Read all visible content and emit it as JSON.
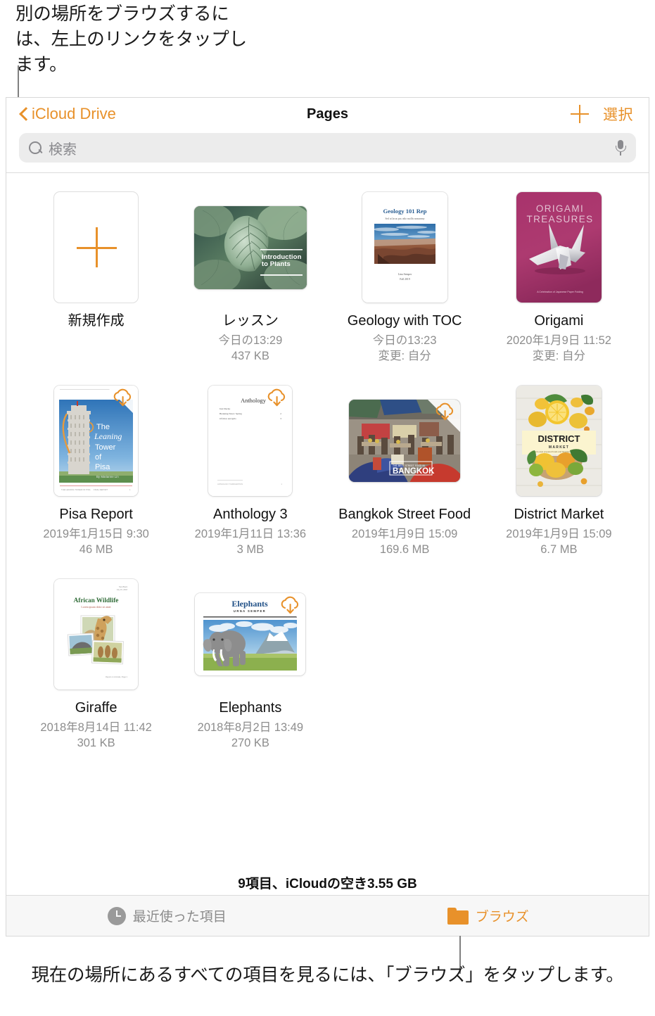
{
  "callouts": {
    "top": "別の場所をブラウズするには、左上のリンクをタップします。",
    "bottom": "現在の場所にあるすべての項目を見るには、「ブラウズ」をタップします。"
  },
  "navbar": {
    "back_label": "iCloud Drive",
    "back_icon": "chevron-left-icon",
    "title": "Pages",
    "add_icon": "plus-icon",
    "select_label": "選択"
  },
  "search": {
    "placeholder": "検索",
    "value": "",
    "icon": "search-icon",
    "mic_icon": "microphone-icon"
  },
  "grid": {
    "new_document_label": "新規作成",
    "items": [
      {
        "title": "レッスン",
        "date": "今日の13:29",
        "size": "437 KB",
        "cloud": false,
        "shape": "landscape",
        "cover": "lesson"
      },
      {
        "title": "Geology with TOC",
        "date": "今日の13:23",
        "size": "変更: 自分",
        "cloud": false,
        "shape": "portrait",
        "cover": "geology"
      },
      {
        "title": "Origami",
        "date": "2020年1月9日 11:52",
        "size": "変更: 自分",
        "cloud": false,
        "shape": "portrait",
        "cover": "origami"
      },
      {
        "title": "Pisa Report",
        "date": "2019年1月15日 9:30",
        "size": "46 MB",
        "cloud": true,
        "shape": "portrait",
        "cover": "pisa"
      },
      {
        "title": "Anthology 3",
        "date": "2019年1月11日 13:36",
        "size": "3 MB",
        "cloud": true,
        "shape": "portrait",
        "cover": "anthology"
      },
      {
        "title": "Bangkok Street Food",
        "date": "2019年1月9日 15:09",
        "size": "169.6 MB",
        "cloud": true,
        "shape": "landscape",
        "cover": "bangkok"
      },
      {
        "title": "District Market",
        "date": "2019年1月9日 15:09",
        "size": "6.7 MB",
        "cloud": false,
        "shape": "portrait",
        "cover": "district"
      },
      {
        "title": "Giraffe",
        "date": "2018年8月14日 11:42",
        "size": "301 KB",
        "cloud": false,
        "shape": "portrait",
        "cover": "giraffe"
      },
      {
        "title": "Elephants",
        "date": "2018年8月2日 13:49",
        "size": "270 KB",
        "cloud": true,
        "shape": "landscape",
        "cover": "elephants"
      }
    ]
  },
  "covers": {
    "lesson": "Introduction to Plants",
    "geology_title": "Geology 101 Rep",
    "geology_sub": "Sed ut lacus pus odio mollis nonummy",
    "geology_author": "Lina Semper",
    "geology_term": "Fall 2019",
    "origami_line1": "ORIGAMI",
    "origami_line2": "TREASURES",
    "origami_foot": "A Celebration of Japanese Paper Folding",
    "pisa_l1": "The",
    "pisa_l2": "Leaning",
    "pisa_l3": "Tower",
    "pisa_l4": "of",
    "pisa_l5": "Pisa",
    "pisa_byline": "By Marianne Lin",
    "anthology_title": "Anthology",
    "anthology_e1": "Just Ducky",
    "anthology_e2": "Breaking News: Spring",
    "anthology_e3": "Of mice and girls",
    "bangkok_kicker": "THE BEST STREET FOOD IN",
    "bangkok_title": "BANGKOK",
    "district_title": "DISTRICT",
    "district_sub": "MARKET",
    "district_foot": "Farm-style prepared foods and favorites for your kitchen",
    "giraffe_title": "African Wildlife",
    "giraffe_sub": "Lorem ipsum dolor sit amet",
    "elephants_title": "Elephants",
    "elephants_sub": "URNA SEMPER"
  },
  "status": {
    "text": "9項目、iCloudの空き3.55 GB"
  },
  "tabbar": {
    "recents": {
      "label": "最近使った項目",
      "icon": "clock-icon"
    },
    "browse": {
      "label": "ブラウズ",
      "icon": "folder-icon"
    }
  },
  "colors": {
    "accent": "#e8912a",
    "text": "#111111",
    "meta": "#8d8d8d",
    "search_bg": "#ececec",
    "tabbar_bg": "#f7f7f7"
  }
}
